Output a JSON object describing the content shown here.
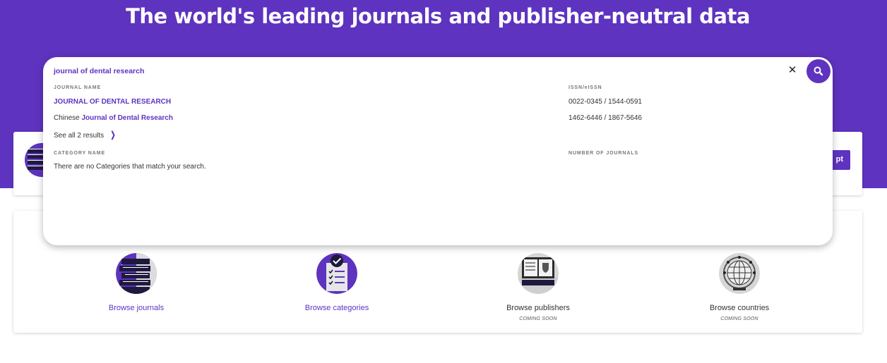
{
  "hero": {
    "title": "The world's leading journals and publisher-neutral data"
  },
  "behind_card": {
    "button_label_fragment": "pt"
  },
  "search": {
    "query": "journal of dental research",
    "journal_name_header": "JOURNAL NAME",
    "issn_header": "ISSN/eISSN",
    "results": [
      {
        "prefix": "",
        "name": "JOURNAL OF DENTAL RESEARCH",
        "issn": "0022-0345 / 1544-0591"
      },
      {
        "prefix": "Chinese ",
        "name": "Journal of Dental Research",
        "issn": "1462-6446 / 1867-5646"
      }
    ],
    "see_all": "See all 2 results",
    "category_header": "CATEGORY NAME",
    "number_header": "NUMBER OF JOURNALS",
    "no_categories": "There are no Categories that match your search."
  },
  "browse": [
    {
      "label": "Browse journals",
      "icon": "journals-icon",
      "coming_soon": ""
    },
    {
      "label": "Browse categories",
      "icon": "categories-icon",
      "coming_soon": ""
    },
    {
      "label": "Browse publishers",
      "icon": "publishers-icon",
      "coming_soon": "COMING SOON"
    },
    {
      "label": "Browse countries",
      "icon": "globe-icon",
      "coming_soon": "COMING SOON"
    }
  ],
  "colors": {
    "brand": "#5e33bf",
    "navy": "#1e1a3e",
    "gray": "#d6d6d6"
  }
}
